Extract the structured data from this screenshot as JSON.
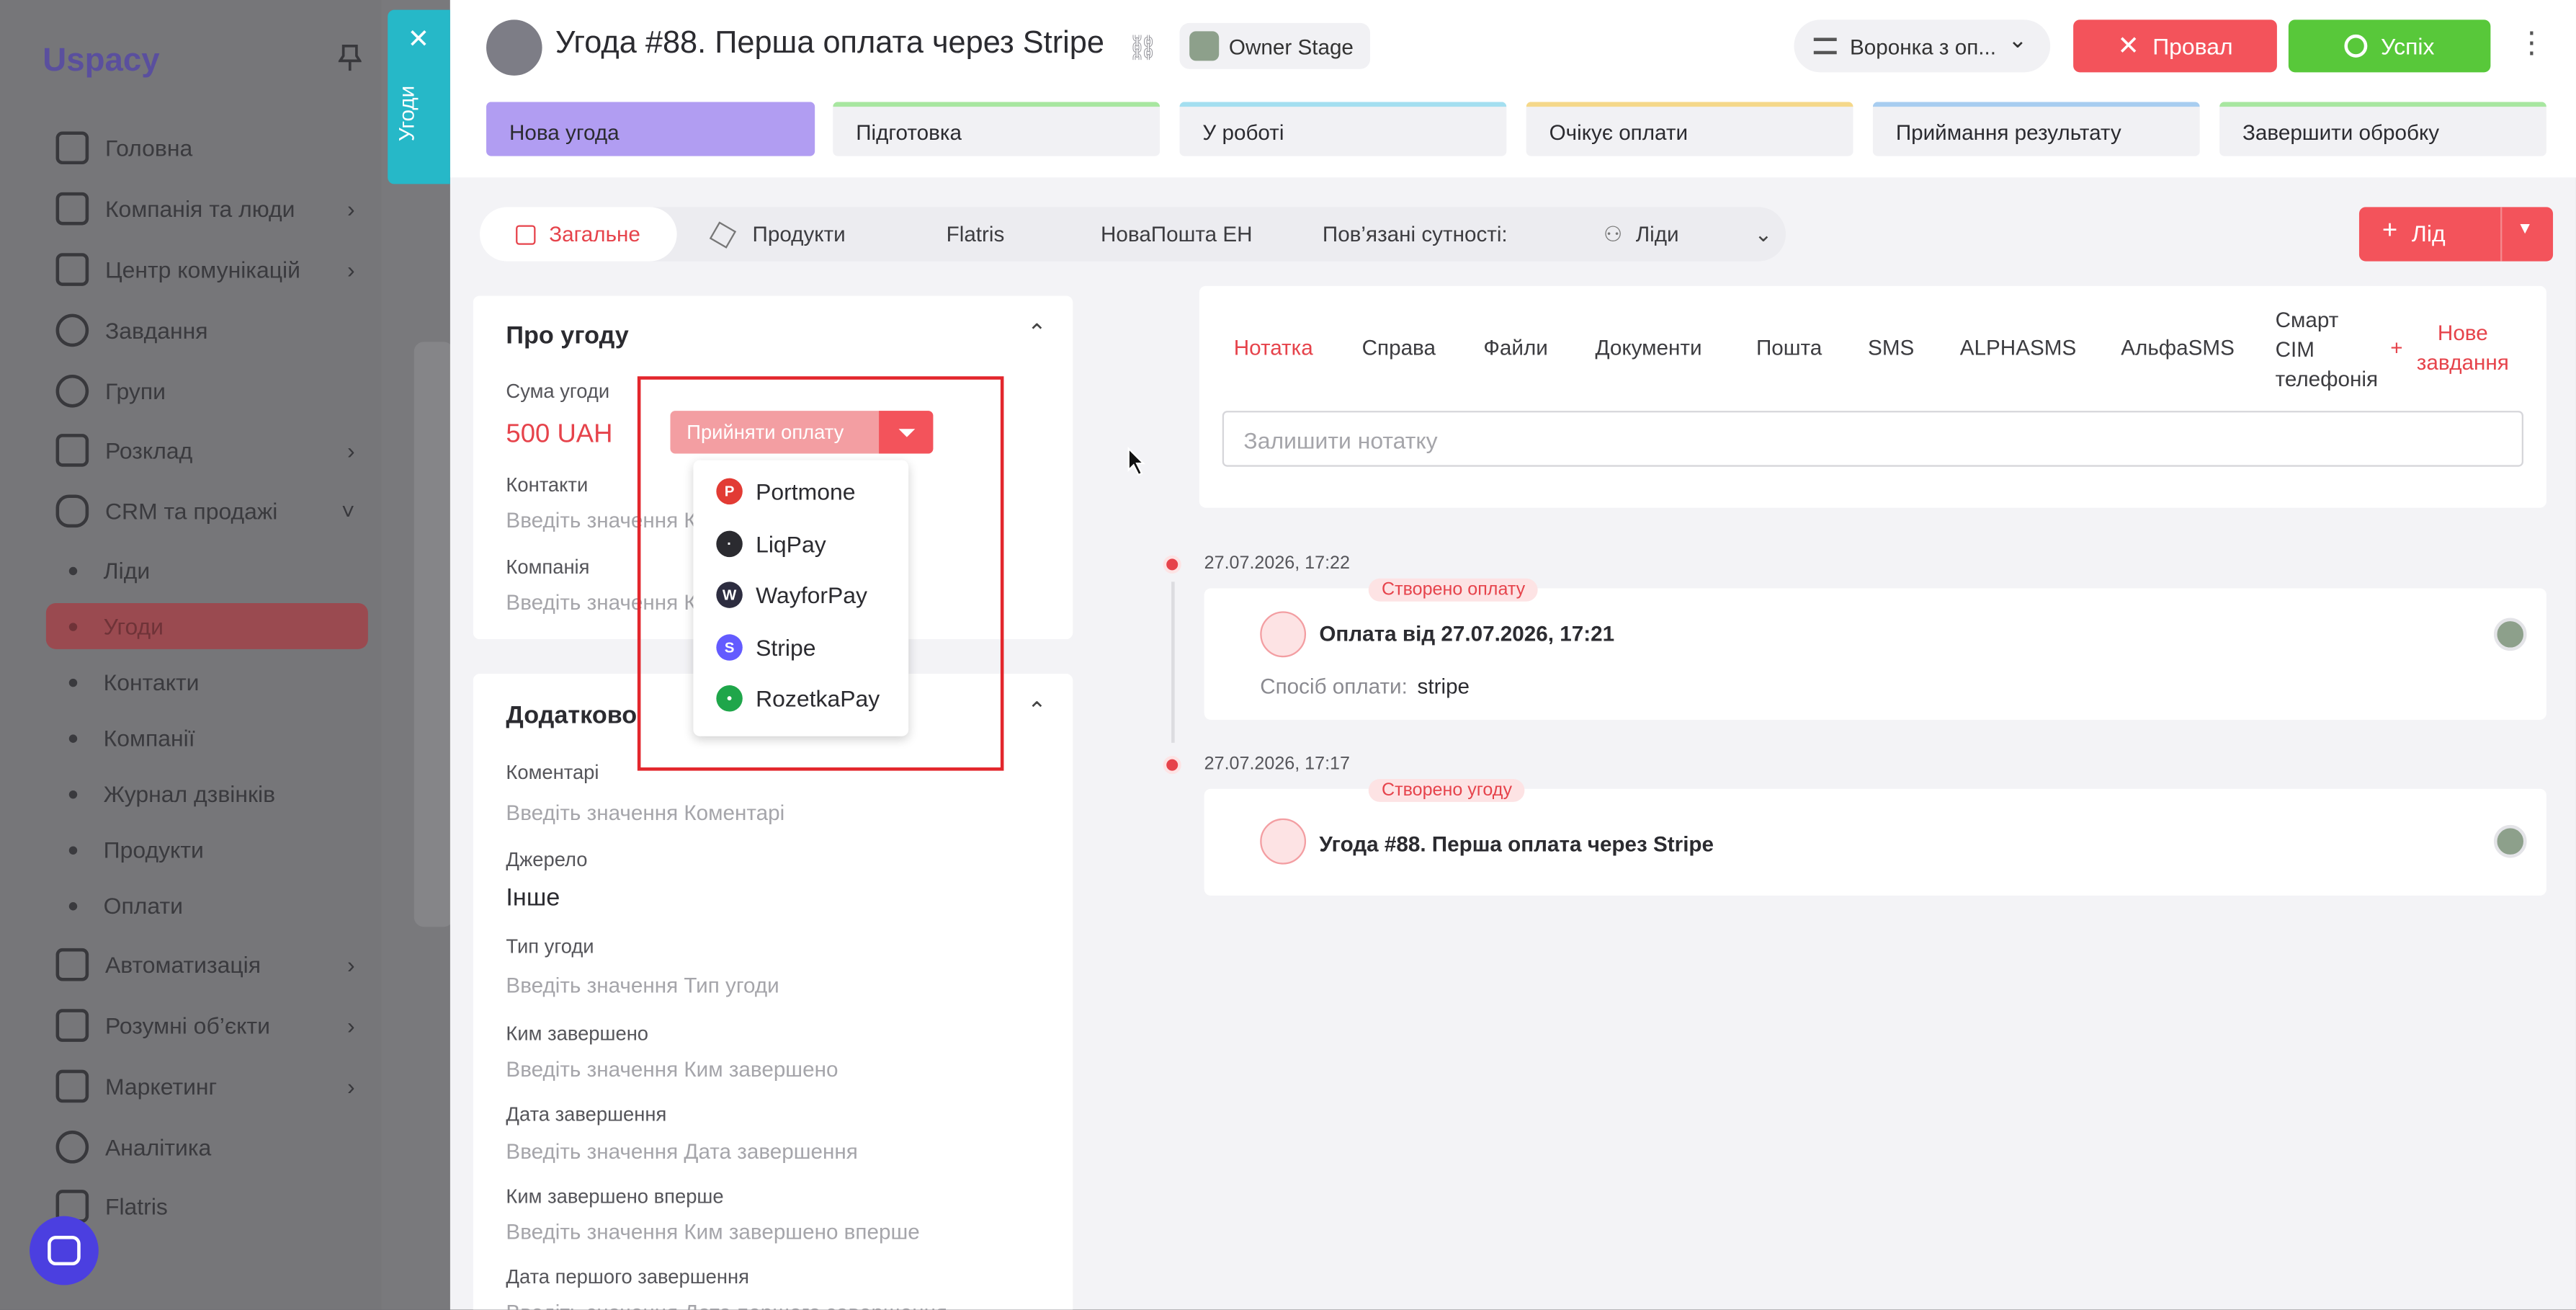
{
  "sidebar": {
    "logo": "spacy",
    "items": [
      {
        "label": "Головна",
        "icon": "home-icon"
      },
      {
        "label": "Компанія та люди",
        "icon": "company-icon"
      },
      {
        "label": "Центр комунікацій",
        "icon": "chat-icon"
      },
      {
        "label": "Завдання",
        "icon": "task-icon"
      },
      {
        "label": "Групи",
        "icon": "groups-icon"
      },
      {
        "label": "Розклад",
        "icon": "calendar-icon"
      },
      {
        "label": "CRM та продажі",
        "icon": "database-icon"
      }
    ],
    "crm_sub": [
      "Ліди",
      "Угоди",
      "Контакти",
      "Компанії",
      "Журнал дзвінків",
      "Продукти",
      "Оплати"
    ],
    "items2": [
      {
        "label": "Автоматизація",
        "icon": "bolt-icon"
      },
      {
        "label": "Розумні об’єкти",
        "icon": "scan-icon"
      },
      {
        "label": "Маркетинг",
        "icon": "marketing-icon"
      },
      {
        "label": "Аналітика",
        "icon": "analytics-icon"
      },
      {
        "label": "Flatris",
        "icon": "flatris-icon"
      }
    ]
  },
  "deals_tab": {
    "label": "Угоди"
  },
  "header": {
    "title": "Угода #88. Перша оплата через Stripe",
    "owner": "Owner Stage",
    "funnel": "Воронка з оп...",
    "fail": "Провал",
    "success": "Успіх"
  },
  "stages": [
    {
      "label": "Нова угода",
      "color": "#b19df2"
    },
    {
      "label": "Підготовка",
      "color": "#a8e6a0"
    },
    {
      "label": "У роботі",
      "color": "#a4dff0"
    },
    {
      "label": "Очікує оплати",
      "color": "#f5d88a"
    },
    {
      "label": "Приймання результату",
      "color": "#a8cdf0"
    },
    {
      "label": "Завершити обробку",
      "color": "#a8e6a0"
    }
  ],
  "subtabs": {
    "general": "Загальне",
    "products": "Продукти",
    "flatris": "Flatris",
    "novaposhta": "НоваПошта ЕН",
    "related": "Пов’язані сутності:",
    "leads": "Ліди",
    "lead_btn": "Лід"
  },
  "about": {
    "title": "Про угоду",
    "sum_label": "Сума угоди",
    "sum_value": "500 UAH",
    "pay_btn": "Прийняти оплату",
    "contacts_label": "Контакти",
    "contacts_ph": "Введіть значення К",
    "company_label": "Компанія",
    "company_ph": "Введіть значення К"
  },
  "payment_providers": [
    {
      "name": "Portmone",
      "color": "#e23b34",
      "letter": "P"
    },
    {
      "name": "LiqPay",
      "color": "#2b2b30",
      "letter": "·"
    },
    {
      "name": "WayforPay",
      "color": "#2d2d40",
      "letter": "W"
    },
    {
      "name": "Stripe",
      "color": "#635bff",
      "letter": "S"
    },
    {
      "name": "RozetkaPay",
      "color": "#1fa64a",
      "letter": "•"
    }
  ],
  "extra": {
    "title": "Додатково",
    "fields": [
      {
        "label": "Коментарі",
        "value": "Введіть значення Коментарі",
        "filled": false
      },
      {
        "label": "Джерело",
        "value": "Інше",
        "filled": true
      },
      {
        "label": "Тип угоди",
        "value": "Введіть значення Тип угоди",
        "filled": false
      },
      {
        "label": "Ким завершено",
        "value": "Введіть значення Ким завершено",
        "filled": false
      },
      {
        "label": "Дата завершення",
        "value": "Введіть значення Дата завершення",
        "filled": false
      },
      {
        "label": "Ким завершено вперше",
        "value": "Введіть значення Ким завершено вперше",
        "filled": false
      },
      {
        "label": "Дата першого завершення",
        "value": "Введіть значення Дата першого завершення",
        "filled": false
      }
    ]
  },
  "activity": {
    "tabs": [
      "Нотатка",
      "Справа",
      "Файли",
      "Документи",
      "Пошта",
      "SMS",
      "ALPHASMS",
      "АльфаSMS"
    ],
    "smart_l1": "Смарт",
    "smart_l2": "СІМ",
    "smart_l3": "телефонія",
    "new_task_l1": "Нове",
    "new_task_l2": "завдання",
    "note_placeholder": "Залишити нотатку"
  },
  "timeline": [
    {
      "date": "27.07.2026, 17:22",
      "badge": "Створено оплату",
      "title": "Оплата від 27.07.2026, 17:21",
      "sub_label": "Спосіб оплати:",
      "sub_value": "stripe"
    },
    {
      "date": "27.07.2026, 17:17",
      "badge": "Створено угоду",
      "title": "Угода #88. Перша оплата через Stripe"
    }
  ]
}
